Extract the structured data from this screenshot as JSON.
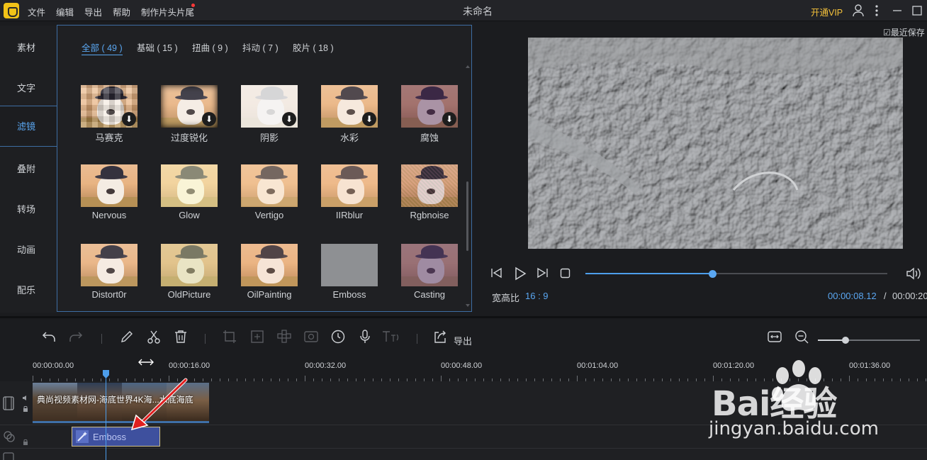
{
  "window": {
    "title": "未命名",
    "vip": "开通VIP",
    "last_saved": "☑最近保存"
  },
  "menu": [
    "文件",
    "编辑",
    "导出",
    "帮助",
    "制作片头片尾"
  ],
  "left_nav": [
    "素材",
    "文字",
    "滤镜",
    "叠附",
    "转场",
    "动画",
    "配乐"
  ],
  "left_nav_active": "滤镜",
  "filter_tabs": [
    "全部 ( 49 )",
    "基础 ( 15 )",
    "扭曲 ( 9 )",
    "抖动 ( 7 )",
    "胶片 ( 18 )"
  ],
  "filters": [
    {
      "label": "马赛克",
      "download": true
    },
    {
      "label": "过度锐化",
      "download": true
    },
    {
      "label": "阴影",
      "download": true
    },
    {
      "label": "水彩",
      "download": true
    },
    {
      "label": "腐蚀",
      "download": true
    },
    {
      "label": "Nervous",
      "download": false
    },
    {
      "label": "Glow",
      "download": false
    },
    {
      "label": "Vertigo",
      "download": false
    },
    {
      "label": "IIRblur",
      "download": false
    },
    {
      "label": "Rgbnoise",
      "download": false
    },
    {
      "label": "Distort0r",
      "download": false
    },
    {
      "label": "OldPicture",
      "download": false
    },
    {
      "label": "OilPainting",
      "download": false
    },
    {
      "label": "Emboss",
      "download": false
    },
    {
      "label": "Casting",
      "download": false
    }
  ],
  "player": {
    "aspect_label": "宽高比",
    "aspect_value": "16 : 9",
    "time_current": "00:00:08.12",
    "time_separator": "/",
    "time_total": "00:00:20",
    "progress": 0.42
  },
  "toolbar": {
    "export_label": "导出",
    "zoom_level": 0.27
  },
  "timeline": {
    "ruler": [
      "00:00:00.00",
      "00:00:16.00",
      "00:00:32.00",
      "00:00:48.00",
      "00:01:04.00",
      "00:01:20.00",
      "00:01:36.00"
    ],
    "video_clip_title": "典尚视频素材网-海底世界4K海...水底海底",
    "filter_clip_label": "Emboss"
  },
  "watermark": {
    "brand": "Bai经验",
    "url": "jingyan.baidu.com"
  },
  "colors": {
    "accent": "#5aa7f2",
    "vip": "#f5c23b",
    "filter_clip": "#3e509e"
  }
}
